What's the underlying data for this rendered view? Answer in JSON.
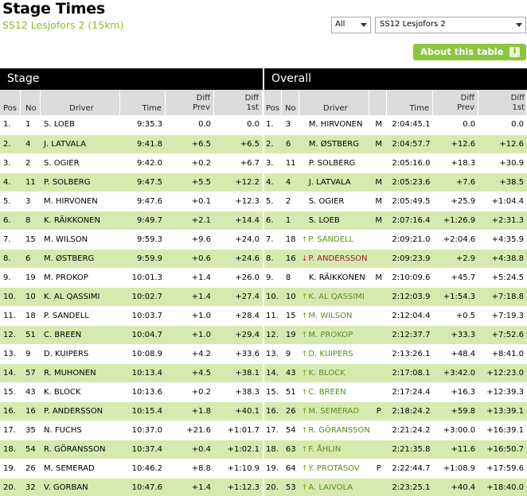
{
  "header": {
    "title": "Stage Times",
    "subtitle": "SS12 Lesjofors 2 (15km)",
    "filter_value": "All",
    "stage_value": "SS12 Lesjofors 2",
    "about_label": "About this table",
    "info_glyph": "i"
  },
  "sections": {
    "stage": "Stage",
    "overall": "Overall"
  },
  "columns": {
    "stage": [
      "Pos",
      "No",
      "Driver",
      "Time",
      "Diff\nPrev",
      "Diff\n1st"
    ],
    "overall": [
      "Pos",
      "No",
      "Driver",
      "",
      "Time",
      "Diff\nPrev",
      "Diff\n1st"
    ]
  },
  "colors": {
    "accent": "#8cc63f",
    "up": "#5ea20b",
    "down": "#c8102e",
    "row_alt": "#d6eab0"
  },
  "stage_rows": [
    [
      "1.",
      "1",
      "S. LOEB",
      "9:35.3",
      "0.0",
      "0.0"
    ],
    [
      "2.",
      "4",
      "J. LATVALA",
      "9:41.8",
      "+6.5",
      "+6.5"
    ],
    [
      "3.",
      "2",
      "S. OGIER",
      "9:42.0",
      "+0.2",
      "+6.7"
    ],
    [
      "4.",
      "11",
      "P. SOLBERG",
      "9:47.5",
      "+5.5",
      "+12.2"
    ],
    [
      "5.",
      "3",
      "M. HIRVONEN",
      "9:47.6",
      "+0.1",
      "+12.3"
    ],
    [
      "6.",
      "8",
      "K. RÄIKKONEN",
      "9:49.7",
      "+2.1",
      "+14.4"
    ],
    [
      "7.",
      "15",
      "M. WILSON",
      "9:59.3",
      "+9.6",
      "+24.0"
    ],
    [
      "8.",
      "6",
      "M. ØSTBERG",
      "9:59.9",
      "+0.6",
      "+24.6"
    ],
    [
      "9.",
      "19",
      "M. PROKOP",
      "10:01.3",
      "+1.4",
      "+26.0"
    ],
    [
      "10.",
      "10",
      "K. AL QASSIMI",
      "10:02.7",
      "+1.4",
      "+27.4"
    ],
    [
      "11.",
      "18",
      "P. SANDELL",
      "10:03.7",
      "+1.0",
      "+28.4"
    ],
    [
      "12.",
      "51",
      "C. BREEN",
      "10:04.7",
      "+1.0",
      "+29.4"
    ],
    [
      "13.",
      "9",
      "D. KUIPERS",
      "10:08.9",
      "+4.2",
      "+33.6"
    ],
    [
      "14.",
      "57",
      "R. MUHONEN",
      "10:13.4",
      "+4.5",
      "+38.1"
    ],
    [
      "15.",
      "43",
      "K. BLOCK",
      "10:13.6",
      "+0.2",
      "+38.3"
    ],
    [
      "16.",
      "16",
      "P. ANDERSSON",
      "10:15.4",
      "+1.8",
      "+40.1"
    ],
    [
      "17.",
      "35",
      "N. FUCHS",
      "10:37.0",
      "+21.6",
      "+1:01.7"
    ],
    [
      "18.",
      "54",
      "R. GÖRANSSON",
      "10:37.4",
      "+0.4",
      "+1:02.1"
    ],
    [
      "19.",
      "26",
      "M. SEMERAD",
      "10:46.2",
      "+8.8",
      "+1:10.9"
    ],
    [
      "20.",
      "32",
      "V. GORBAN",
      "10:47.6",
      "+1.4",
      "+1:12.3"
    ]
  ],
  "overall_rows": [
    {
      "pos": "1.",
      "no": "3",
      "trend": "",
      "driver": "M. HIRVONEN",
      "cls": "M",
      "time": "2:04:45.1",
      "prev": "0.0",
      "first": "0.0"
    },
    {
      "pos": "2.",
      "no": "6",
      "trend": "",
      "driver": "M. ØSTBERG",
      "cls": "M",
      "time": "2:04:57.7",
      "prev": "+12.6",
      "first": "+12.6"
    },
    {
      "pos": "3.",
      "no": "11",
      "trend": "",
      "driver": "P. SOLBERG",
      "cls": "",
      "time": "2:05:16.0",
      "prev": "+18.3",
      "first": "+30.9"
    },
    {
      "pos": "4.",
      "no": "4",
      "trend": "",
      "driver": "J. LATVALA",
      "cls": "M",
      "time": "2:05:23.6",
      "prev": "+7.6",
      "first": "+38.5"
    },
    {
      "pos": "5.",
      "no": "2",
      "trend": "",
      "driver": "S. OGIER",
      "cls": "M",
      "time": "2:05:49.5",
      "prev": "+25.9",
      "first": "+1:04.4"
    },
    {
      "pos": "6.",
      "no": "1",
      "trend": "",
      "driver": "S. LOEB",
      "cls": "M",
      "time": "2:07:16.4",
      "prev": "+1:26.9",
      "first": "+2:31.3"
    },
    {
      "pos": "7.",
      "no": "18",
      "trend": "up",
      "driver": "P. SANDELL",
      "cls": "",
      "time": "2:09:21.0",
      "prev": "+2:04.6",
      "first": "+4:35.9"
    },
    {
      "pos": "8.",
      "no": "16",
      "trend": "down",
      "driver": "P. ANDERSSON",
      "cls": "",
      "time": "2:09:23.9",
      "prev": "+2.9",
      "first": "+4:38.8"
    },
    {
      "pos": "9.",
      "no": "8",
      "trend": "",
      "driver": "K. RÄIKKONEN",
      "cls": "M",
      "time": "2:10:09.6",
      "prev": "+45.7",
      "first": "+5:24.5"
    },
    {
      "pos": "10.",
      "no": "10",
      "trend": "up",
      "driver": "K. AL QASSIMI",
      "cls": "",
      "time": "2:12:03.9",
      "prev": "+1:54.3",
      "first": "+7:18.8"
    },
    {
      "pos": "11.",
      "no": "15",
      "trend": "up",
      "driver": "M. WILSON",
      "cls": "",
      "time": "2:12:04.4",
      "prev": "+0.5",
      "first": "+7:19.3"
    },
    {
      "pos": "12.",
      "no": "19",
      "trend": "up",
      "driver": "M. PROKOP",
      "cls": "",
      "time": "2:12:37.7",
      "prev": "+33.3",
      "first": "+7:52.6"
    },
    {
      "pos": "13.",
      "no": "9",
      "trend": "up",
      "driver": "D. KUIPERS",
      "cls": "",
      "time": "2:13:26.1",
      "prev": "+48.4",
      "first": "+8:41.0"
    },
    {
      "pos": "14.",
      "no": "43",
      "trend": "up",
      "driver": "K. BLOCK",
      "cls": "",
      "time": "2:17:08.1",
      "prev": "+3:42.0",
      "first": "+12:23.0"
    },
    {
      "pos": "15.",
      "no": "51",
      "trend": "up",
      "driver": "C. BREEN",
      "cls": "",
      "time": "2:17:24.4",
      "prev": "+16.3",
      "first": "+12:39.3"
    },
    {
      "pos": "16.",
      "no": "26",
      "trend": "up",
      "driver": "M. SEMERAD",
      "cls": "P",
      "time": "2:18:24.2",
      "prev": "+59.8",
      "first": "+13:39.1"
    },
    {
      "pos": "17.",
      "no": "54",
      "trend": "up",
      "driver": "R. GÖRANSSON",
      "cls": "",
      "time": "2:21:24.2",
      "prev": "+3:00.0",
      "first": "+16:39.1"
    },
    {
      "pos": "18.",
      "no": "63",
      "trend": "up",
      "driver": "F. ÅHLIN",
      "cls": "",
      "time": "2:21:35.8",
      "prev": "+11.6",
      "first": "+16:50.7"
    },
    {
      "pos": "19.",
      "no": "64",
      "trend": "up",
      "driver": "Y. PROTASOV",
      "cls": "P",
      "time": "2:22:44.7",
      "prev": "+1:08.9",
      "first": "+17:59.6"
    },
    {
      "pos": "20.",
      "no": "53",
      "trend": "up",
      "driver": "A. LAIVOLA",
      "cls": "",
      "time": "2:23:25.1",
      "prev": "+40.4",
      "first": "+18:40.0"
    }
  ]
}
